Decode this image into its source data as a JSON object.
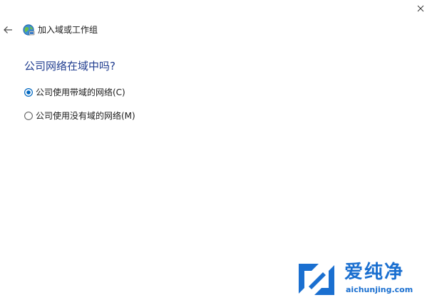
{
  "window": {
    "title": "加入域或工作组"
  },
  "icons": {
    "close": "close-icon",
    "back": "back-arrow-icon",
    "title": "network-globe-icon"
  },
  "question": {
    "heading": "公司网络在域中吗?"
  },
  "options": [
    {
      "label": "公司使用带域的网络(C)",
      "selected": true
    },
    {
      "label": "公司使用没有域的网络(M)",
      "selected": false
    }
  ],
  "colors": {
    "accent": "#0067c0",
    "heading": "#1f3c8f",
    "watermark": "#1a6fd0"
  },
  "watermark": {
    "brand": "爱纯净",
    "url": "aichunjing.com"
  }
}
